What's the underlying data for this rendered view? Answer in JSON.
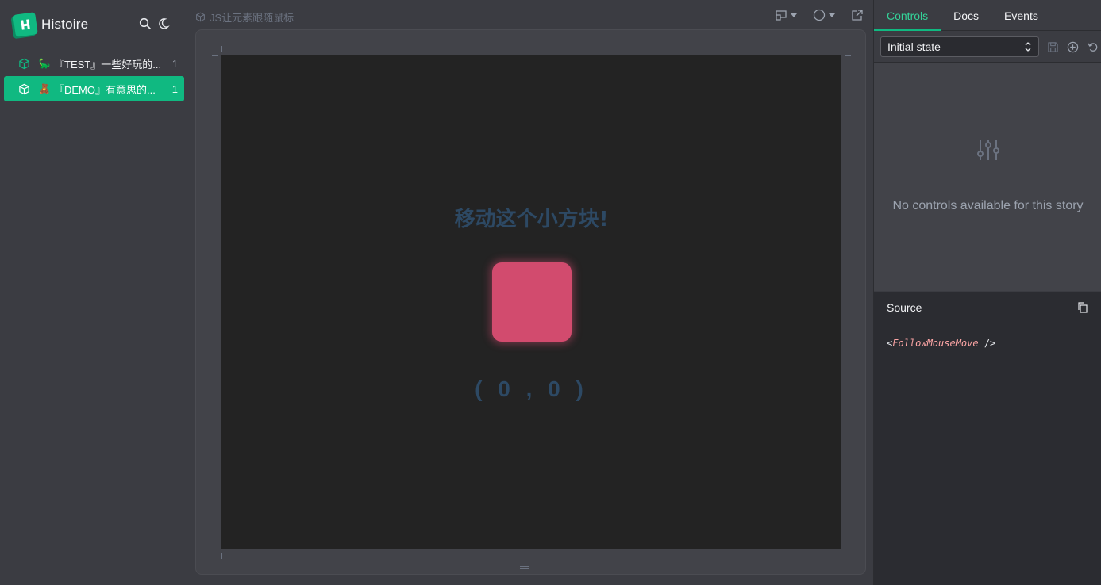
{
  "app": {
    "name": "Histoire"
  },
  "sidebar": {
    "stories": [
      {
        "emoji": "🦕",
        "label": "『TEST』一些好玩的...",
        "count": "1",
        "active": false
      },
      {
        "emoji": "🧸",
        "label": "『DEMO』有意思的...",
        "count": "1",
        "active": true
      }
    ]
  },
  "toolbar": {
    "story_title": "JS让元素跟随鼠标"
  },
  "preview": {
    "heading": "移动这个小方块!",
    "coords": "( 0 , 0 )"
  },
  "panel": {
    "tabs": [
      "Controls",
      "Docs",
      "Events"
    ],
    "active_tab": "Controls",
    "state_select": "Initial state",
    "empty_text": "No controls available for this story",
    "source_title": "Source",
    "source_component": "FollowMouseMove"
  },
  "colors": {
    "accent": "#10b981",
    "box": "#d24b6e",
    "heading": "#2d4964"
  },
  "icons": [
    "histoire-logo-icon",
    "search-icon",
    "moon-icon",
    "cube-icon",
    "responsive-icon",
    "background-icon",
    "external-link-icon",
    "save-icon",
    "add-icon",
    "reset-icon",
    "sliders-icon",
    "copy-icon"
  ]
}
